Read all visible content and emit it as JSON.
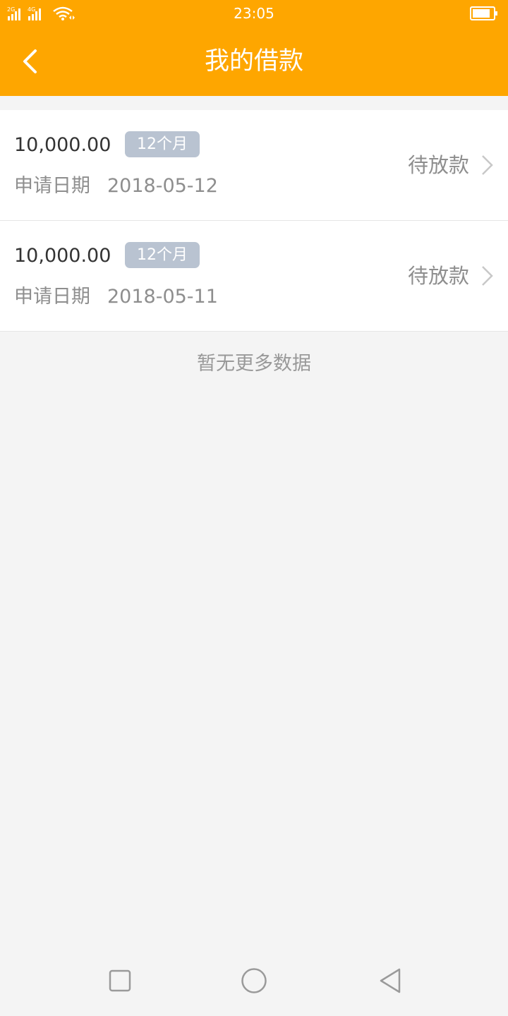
{
  "status_bar": {
    "signal_1_label": "2G",
    "signal_2_label": "4G",
    "time": "23:05",
    "icons": [
      "signal-icon",
      "wifi-icon",
      "battery-icon"
    ]
  },
  "app_bar": {
    "title": "我的借款",
    "back_icon": "back-arrow-icon"
  },
  "loans": [
    {
      "amount": "10,000.00",
      "term": "12个月",
      "date_label": "申请日期",
      "date": "2018-05-12",
      "status": "待放款"
    },
    {
      "amount": "10,000.00",
      "term": "12个月",
      "date_label": "申请日期",
      "date": "2018-05-11",
      "status": "待放款"
    }
  ],
  "list_footer": "暂无更多数据",
  "nav": {
    "icons": [
      "recent-apps-icon",
      "home-icon",
      "back-icon"
    ]
  },
  "colors": {
    "brand": "#fea600",
    "badge": "#b9c3d1",
    "background": "#f4f4f4"
  }
}
